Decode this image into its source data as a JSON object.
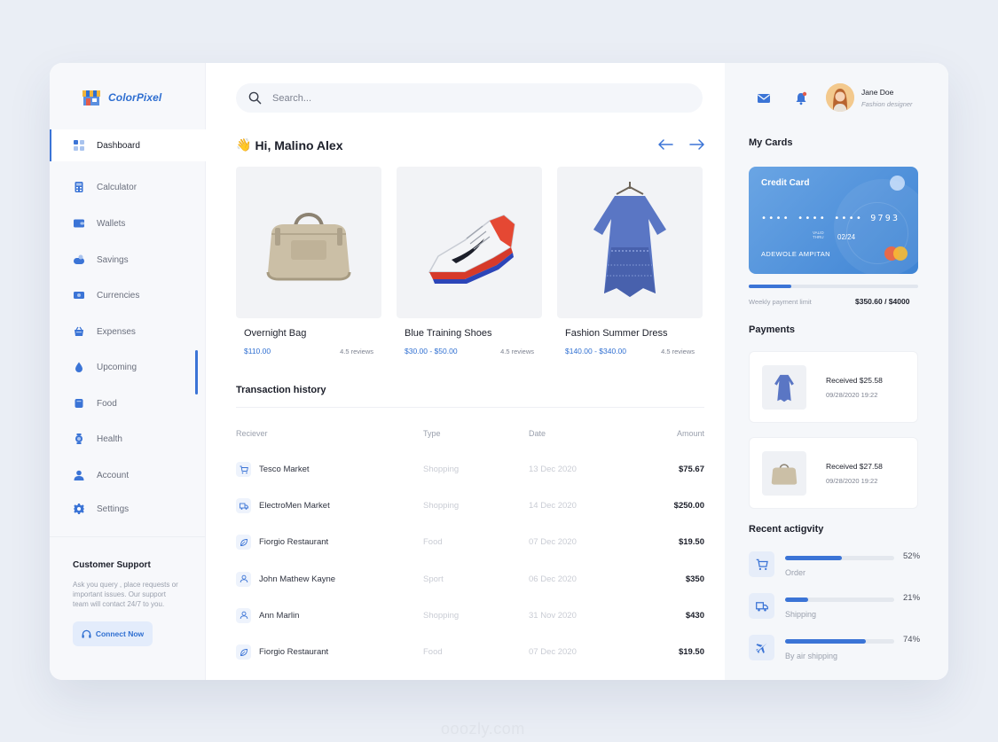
{
  "brand": {
    "name": "ColorPixel",
    "accent": "#3b74d6"
  },
  "sidebar": {
    "items": [
      {
        "label": "Dashboard",
        "icon": "dashboard-icon",
        "active": true
      },
      {
        "label": "Calculator",
        "icon": "calculator-icon"
      },
      {
        "label": "Wallets",
        "icon": "wallet-icon"
      },
      {
        "label": "Savings",
        "icon": "savings-icon"
      },
      {
        "label": "Currencies",
        "icon": "currency-icon"
      },
      {
        "label": "Expenses",
        "icon": "expenses-icon"
      },
      {
        "label": "Upcoming",
        "icon": "drop-icon"
      },
      {
        "label": "Food",
        "icon": "food-icon"
      },
      {
        "label": "Health",
        "icon": "health-icon"
      },
      {
        "label": "Account",
        "icon": "user-icon"
      },
      {
        "label": "Settings",
        "icon": "gear-icon"
      }
    ],
    "support": {
      "title": "Customer Support",
      "text": "Ask you query , place requests or important issues. Our support team will contact 24/7 to you.",
      "button": "Connect Now"
    }
  },
  "search": {
    "placeholder": "Search..."
  },
  "greeting": {
    "emoji": "👋",
    "text": "Hi, Malino Alex"
  },
  "products": [
    {
      "name": "Overnight Bag",
      "price": "$110.00",
      "reviews": "4.5 reviews"
    },
    {
      "name": "Blue Training Shoes",
      "price": "$30.00 - $50.00",
      "reviews": "4.5 reviews"
    },
    {
      "name": "Fashion Summer Dress",
      "price": "$140.00 - $340.00",
      "reviews": "4.5 reviews"
    }
  ],
  "transactions": {
    "title": "Transaction history",
    "headers": [
      "Reciever",
      "Type",
      "Date",
      "Amount"
    ],
    "rows": [
      {
        "receiver": "Tesco Market",
        "type": "Shopping",
        "date": "13 Dec 2020",
        "amount": "$75.67",
        "icon": "cart-icon"
      },
      {
        "receiver": "ElectroMen Market",
        "type": "Shopping",
        "date": "14 Dec 2020",
        "amount": "$250.00",
        "icon": "truck-icon"
      },
      {
        "receiver": "Fiorgio Restaurant",
        "type": "Food",
        "date": "07 Dec 2020",
        "amount": "$19.50",
        "icon": "leaf-icon"
      },
      {
        "receiver": "John Mathew Kayne",
        "type": "Sport",
        "date": "06 Dec 2020",
        "amount": "$350",
        "icon": "user-icon"
      },
      {
        "receiver": "Ann Marlin",
        "type": "Shopping",
        "date": "31 Nov 2020",
        "amount": "$430",
        "icon": "user-icon"
      },
      {
        "receiver": "Fiorgio Restaurant",
        "type": "Food",
        "date": "07 Dec 2020",
        "amount": "$19.50",
        "icon": "leaf-icon"
      }
    ]
  },
  "profile": {
    "name": "Jane Doe",
    "role": "Fashion designer"
  },
  "cards": {
    "title": "My Cards",
    "card_label": "Credit Card",
    "number": "•••• •••• •••• 9793",
    "valid_label": "VALID THRU",
    "valid": "02/24",
    "holder": "ADEWOLE AMPITAN",
    "limit_label": "Weekly payment limit",
    "limit_value": "$350.60 / $4000",
    "limit_fraction": 0.25
  },
  "payments": {
    "title": "Payments",
    "items": [
      {
        "received": "Received $25.58",
        "date": "09/28/2020 19:22",
        "thumb": "dress-thumb"
      },
      {
        "received": "Received $27.58",
        "date": "09/28/2020 19:22",
        "thumb": "bag-thumb"
      }
    ]
  },
  "activity": {
    "title": "Recent actigvity",
    "items": [
      {
        "label": "Order",
        "pct": "52%",
        "value": 0.52,
        "icon": "cart-icon"
      },
      {
        "label": "Shipping",
        "pct": "21%",
        "value": 0.21,
        "icon": "truck-icon"
      },
      {
        "label": "By air shipping",
        "pct": "74%",
        "value": 0.74,
        "icon": "plane-icon"
      }
    ]
  },
  "watermark": "ooozly.com"
}
